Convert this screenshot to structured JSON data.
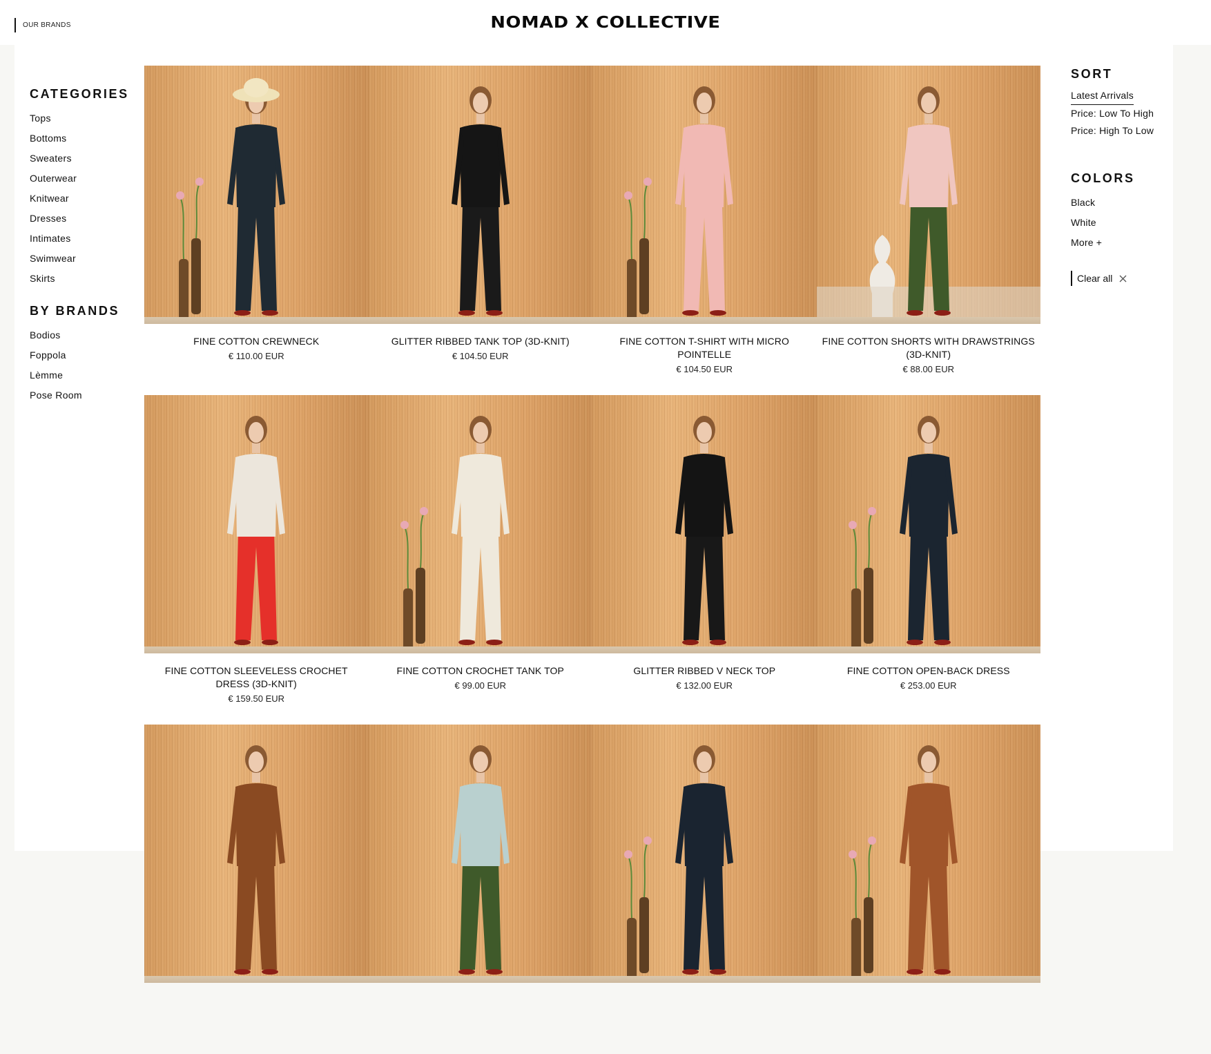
{
  "header": {
    "our_brands": "OUR BRANDS",
    "logo": "NOMAD X COLLECTIVE"
  },
  "categories": {
    "heading": "CATEGORIES",
    "items": [
      "Tops",
      "Bottoms",
      "Sweaters",
      "Outerwear",
      "Knitwear",
      "Dresses",
      "Intimates",
      "Swimwear",
      "Skirts"
    ]
  },
  "brands": {
    "heading": "BY BRANDS",
    "items": [
      "Bodios",
      "Foppola",
      "Lèmme",
      "Pose Room"
    ]
  },
  "sort": {
    "heading": "SORT",
    "items": [
      "Latest Arrivals",
      "Price: Low To High",
      "Price: High To Low"
    ],
    "active": "Latest Arrivals"
  },
  "colors": {
    "heading": "COLORS",
    "items": [
      "Black",
      "White",
      "More +"
    ]
  },
  "clear_all": "Clear all",
  "products": [
    {
      "name": "FINE COTTON CREWNECK",
      "price": "€ 110.00 EUR",
      "outfit": "#1f2a33",
      "bottom": "#1f2a33",
      "accessory": "hat-and-vases"
    },
    {
      "name": "GLITTER RIBBED TANK TOP (3D-KNIT)",
      "price": "€ 104.50 EUR",
      "outfit": "#151515",
      "bottom": "#1a1a1a",
      "accessory": "none"
    },
    {
      "name": "FINE COTTON T-SHIRT WITH MICRO POINTELLE",
      "price": "€ 104.50 EUR",
      "outfit": "#f1b9b4",
      "bottom": "#f1b9b4",
      "accessory": "vases"
    },
    {
      "name": "FINE COTTON SHORTS WITH DRAWSTRINGS (3D-KNIT)",
      "price": "€ 88.00 EUR",
      "outfit": "#f0c6c0",
      "bottom": "#3f5a2a",
      "accessory": "sculpture"
    },
    {
      "name": "FINE COTTON SLEEVELESS CROCHET DRESS (3D-KNIT)",
      "price": "€ 159.50 EUR",
      "outfit": "#ece6dc",
      "bottom": "#e5302a",
      "accessory": "none"
    },
    {
      "name": "FINE COTTON CROCHET TANK TOP",
      "price": "€ 99.00 EUR",
      "outfit": "#efe9dc",
      "bottom": "#efe9dc",
      "accessory": "vases"
    },
    {
      "name": "GLITTER RIBBED V NECK TOP",
      "price": "€ 132.00 EUR",
      "outfit": "#141414",
      "bottom": "#181818",
      "accessory": "none"
    },
    {
      "name": "FINE COTTON OPEN-BACK DRESS",
      "price": "€ 253.00 EUR",
      "outfit": "#1b2530",
      "bottom": "#1b2530",
      "accessory": "vases"
    },
    {
      "name": "",
      "price": "",
      "outfit": "#8a4a22",
      "bottom": "#8a4a22",
      "accessory": "none"
    },
    {
      "name": "",
      "price": "",
      "outfit": "#b9d0cf",
      "bottom": "#3f5a2a",
      "accessory": "none"
    },
    {
      "name": "",
      "price": "",
      "outfit": "#1a2430",
      "bottom": "#1a2430",
      "accessory": "vases"
    },
    {
      "name": "",
      "price": "",
      "outfit": "#a0552a",
      "bottom": "#a0552a",
      "accessory": "vases"
    }
  ]
}
